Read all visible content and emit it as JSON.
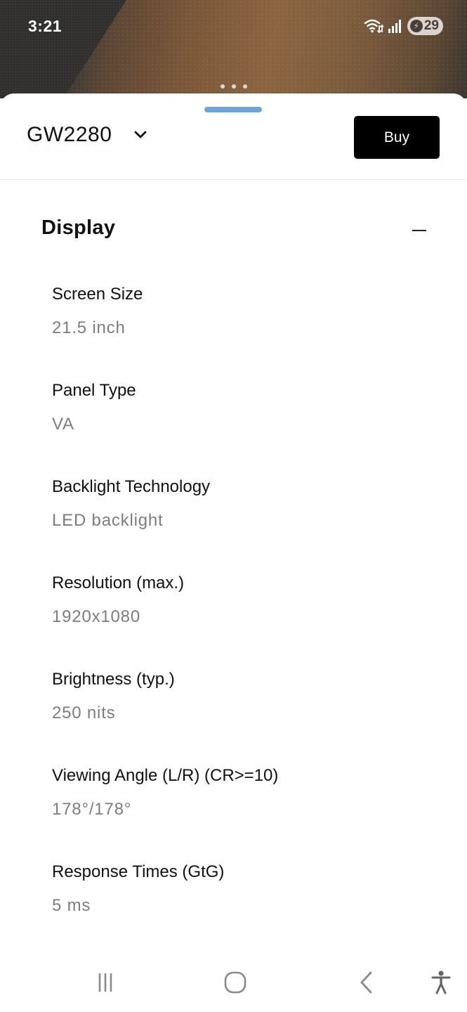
{
  "status_bar": {
    "time": "3:21",
    "battery_level": "29",
    "icons": [
      "wifi-icon",
      "signal-icon",
      "battery-charging-icon"
    ]
  },
  "header": {
    "model": "GW2280",
    "buy_label": "Buy"
  },
  "section": {
    "title": "Display",
    "expanded": true
  },
  "specs": [
    {
      "label": "Screen Size",
      "value": "21.5 inch"
    },
    {
      "label": "Panel Type",
      "value": "VA"
    },
    {
      "label": "Backlight Technology",
      "value": "LED backlight"
    },
    {
      "label": "Resolution (max.)",
      "value": "1920x1080"
    },
    {
      "label": "Brightness (typ.)",
      "value": "250 nits"
    },
    {
      "label": "Viewing Angle (L/R) (CR>=10)",
      "value": "178°/178°"
    },
    {
      "label": "Response Times (GtG)",
      "value": "5 ms"
    }
  ],
  "nav_bar": {
    "buttons": [
      "recent-apps-icon",
      "home-icon",
      "back-icon",
      "accessibility-icon"
    ]
  },
  "colors": {
    "accent_handle": "#6fa3dd",
    "buy_button": "#000000",
    "label_text": "#111111",
    "value_text": "#7d7d7d"
  }
}
